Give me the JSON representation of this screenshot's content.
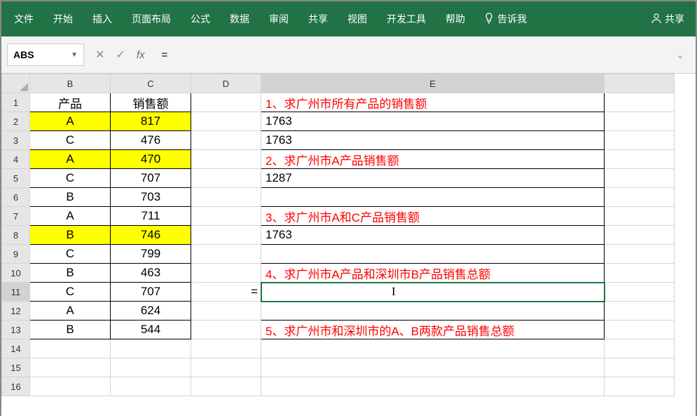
{
  "ribbon": {
    "tabs": [
      "文件",
      "开始",
      "插入",
      "页面布局",
      "公式",
      "数据",
      "审阅",
      "共享",
      "视图",
      "开发工具",
      "帮助"
    ],
    "tell_me": "告诉我",
    "share": "共享"
  },
  "formula_bar": {
    "name_box": "ABS",
    "formula_value": "="
  },
  "columns": [
    "B",
    "C",
    "D",
    "E"
  ],
  "headers": {
    "B": "产品",
    "C": "销售额"
  },
  "rows": [
    {
      "n": 1,
      "b": "产品",
      "c": "销售额",
      "e": "1、求广州市所有产品的销售额",
      "e_red": true,
      "b_header": true
    },
    {
      "n": 2,
      "b": "A",
      "c": "817",
      "e": "1763",
      "yellow": true
    },
    {
      "n": 3,
      "b": "C",
      "c": "476",
      "e": "1763"
    },
    {
      "n": 4,
      "b": "A",
      "c": "470",
      "e": "2、求广州市A产品销售额",
      "e_red": true,
      "yellow": true
    },
    {
      "n": 5,
      "b": "C",
      "c": "707",
      "e": "1287"
    },
    {
      "n": 6,
      "b": "B",
      "c": "703",
      "e": ""
    },
    {
      "n": 7,
      "b": "A",
      "c": "711",
      "e": "3、求广州市A和C产品销售额",
      "e_red": true
    },
    {
      "n": 8,
      "b": "B",
      "c": "746",
      "e": "1763",
      "yellow": true
    },
    {
      "n": 9,
      "b": "C",
      "c": "799",
      "e": ""
    },
    {
      "n": 10,
      "b": "B",
      "c": "463",
      "e": "4、求广州市A产品和深圳市B产品销售总额",
      "e_red": true
    },
    {
      "n": 11,
      "b": "C",
      "c": "707",
      "d": "=",
      "e": "",
      "active": true
    },
    {
      "n": 12,
      "b": "A",
      "c": "624",
      "e": ""
    },
    {
      "n": 13,
      "b": "B",
      "c": "544",
      "e": "5、求广州市和深圳市的A、B两款产品销售总额",
      "e_red": true
    },
    {
      "n": 14
    },
    {
      "n": 15
    },
    {
      "n": 16
    }
  ]
}
